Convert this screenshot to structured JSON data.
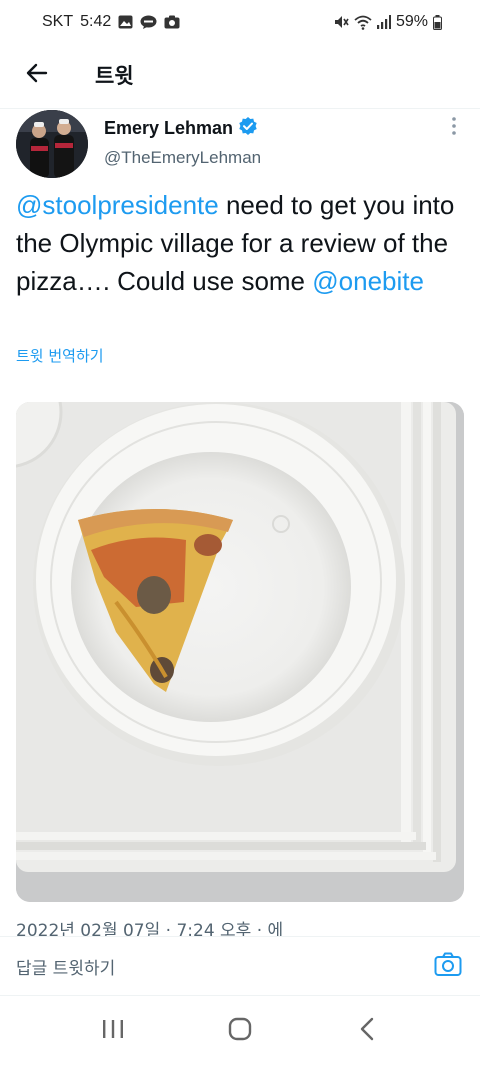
{
  "status_bar": {
    "carrier": "SKT",
    "time": "5:42",
    "left_icons": [
      "gallery-icon",
      "talk-bubble-icon",
      "camera-icon"
    ],
    "right_icons": [
      "mute-icon",
      "wifi-icon",
      "signal-icon",
      "battery-icon"
    ],
    "battery": "59%"
  },
  "header": {
    "back_icon": "arrow-left-icon",
    "title": "트윗"
  },
  "tweet": {
    "author_name": "Emery Lehman",
    "author_handle": "@TheEmeryLehman",
    "verified_icon": "verified-badge-icon",
    "more_icon": "more-vertical-icon",
    "text_parts": [
      {
        "text": "@stoolpresidente",
        "type": "mention"
      },
      {
        "text": " need to get you into the Olympic village for a review of the pizza…. Could use some ",
        "type": "text"
      },
      {
        "text": "@onebite",
        "type": "mention"
      }
    ],
    "translate_label": "트윗 번역하기",
    "meta": "2022년 02월 07일 · 7:24 오후 · 에"
  },
  "reply": {
    "placeholder": "답글 트윗하기",
    "camera_icon": "camera-icon"
  },
  "nav": {
    "buttons": [
      "recent-apps-icon",
      "home-icon",
      "back-icon"
    ]
  },
  "colors": {
    "accent": "#1d9bf0",
    "text": "#0f1419",
    "secondary": "#536471",
    "divider": "#eff3f4"
  }
}
